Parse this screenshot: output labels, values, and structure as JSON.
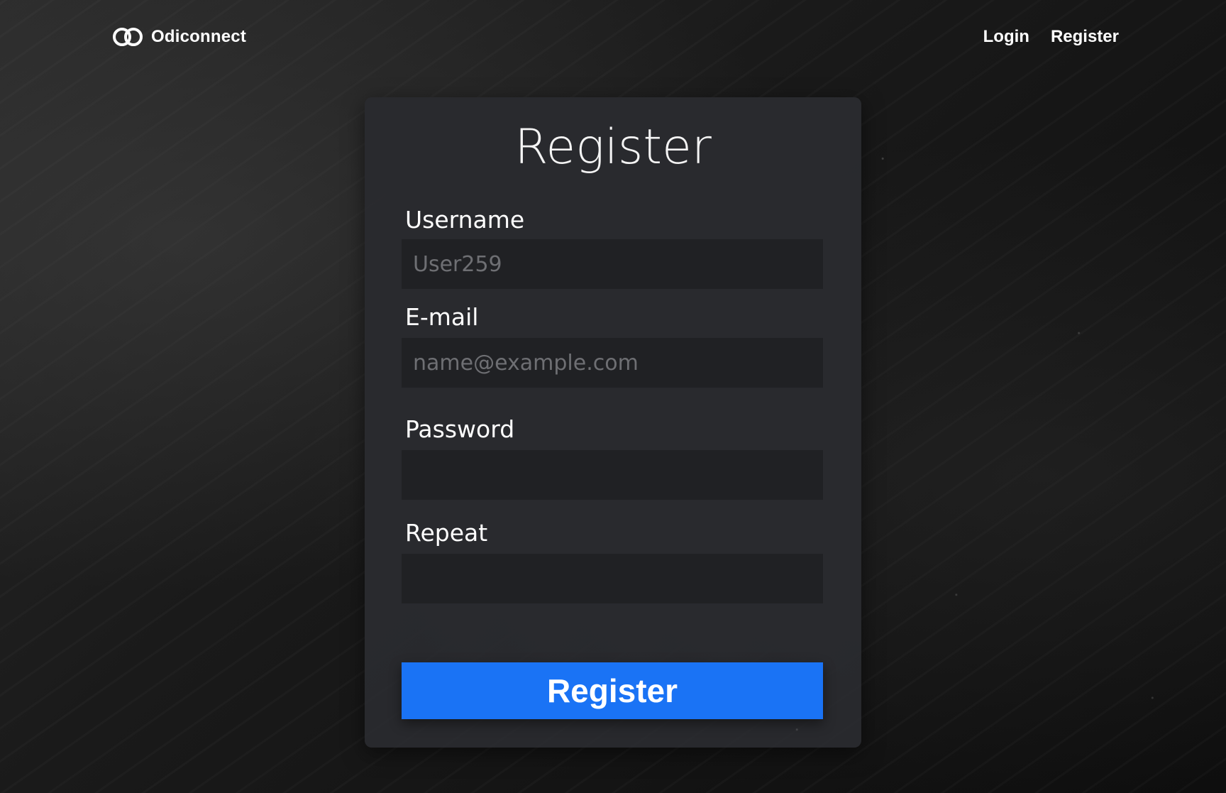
{
  "brand": {
    "name": "Odiconnect"
  },
  "nav": {
    "login": "Login",
    "register": "Register"
  },
  "form": {
    "title": "Register",
    "username": {
      "label": "Username",
      "placeholder": "User259",
      "value": ""
    },
    "email": {
      "label": "E-mail",
      "placeholder": "name@example.com",
      "value": ""
    },
    "password": {
      "label": "Password",
      "value": ""
    },
    "repeat": {
      "label": "Repeat",
      "value": ""
    },
    "submit_label": "Register"
  },
  "colors": {
    "accent": "#1a73f5",
    "card_bg": "#2a2b2f",
    "input_bg": "#202124"
  }
}
